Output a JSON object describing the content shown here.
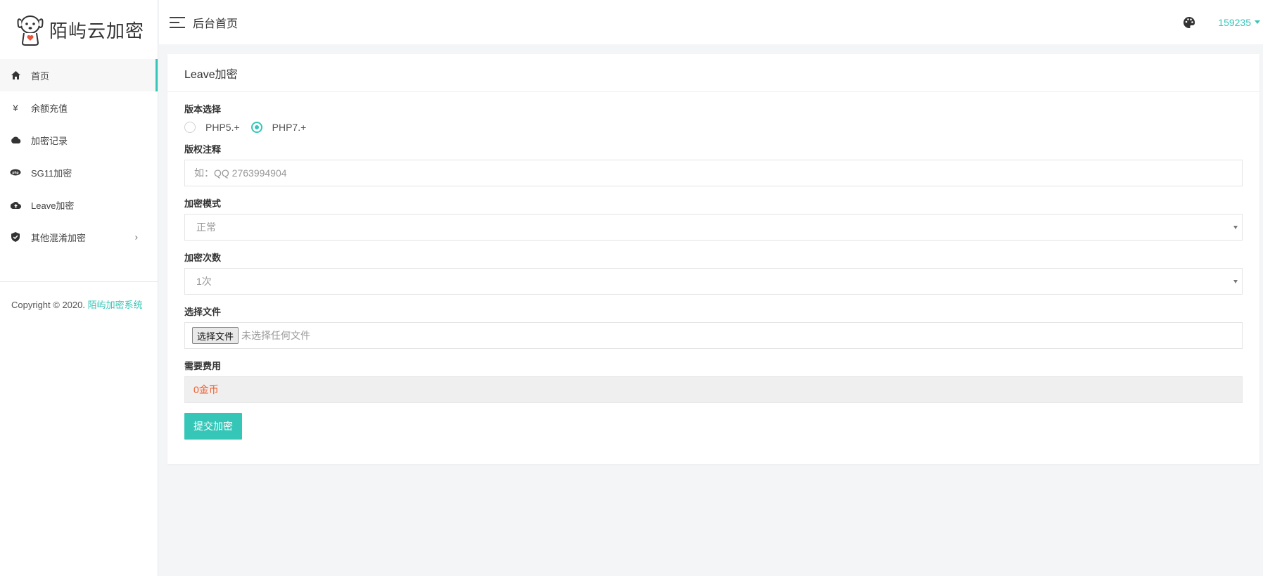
{
  "logo": {
    "text": "陌屿云加密"
  },
  "sidebar": {
    "items": [
      {
        "label": "首页",
        "icon": "home-icon"
      },
      {
        "label": "余额充值",
        "icon": "yen-icon"
      },
      {
        "label": "加密记录",
        "icon": "cloud-icon"
      },
      {
        "label": "SG11加密",
        "icon": "php-icon"
      },
      {
        "label": "Leave加密",
        "icon": "cloud-upload-icon"
      },
      {
        "label": "其他混淆加密",
        "icon": "shield-check-icon"
      }
    ],
    "arrow": "›",
    "copyright_prefix": "Copyright © 2020. ",
    "copyright_brand": "陌屿加密系统"
  },
  "header": {
    "title": "后台首页",
    "username": "159235"
  },
  "card": {
    "title": "Leave加密",
    "version": {
      "label": "版本选择",
      "options": [
        "PHP5.+",
        "PHP7.+"
      ],
      "selected": "PHP7.+"
    },
    "copyright_note": {
      "label": "版权注释",
      "placeholder": "如：QQ 2763994904"
    },
    "mode": {
      "label": "加密模式",
      "value": "正常"
    },
    "times": {
      "label": "加密次数",
      "value": "1次"
    },
    "file": {
      "label": "选择文件",
      "button": "选择文件",
      "status": "未选择任何文件"
    },
    "fee": {
      "label": "需要费用",
      "value": "0金币"
    },
    "submit": "提交加密"
  },
  "colors": {
    "accent": "#36c6b8",
    "fee_text": "#f05a28"
  }
}
